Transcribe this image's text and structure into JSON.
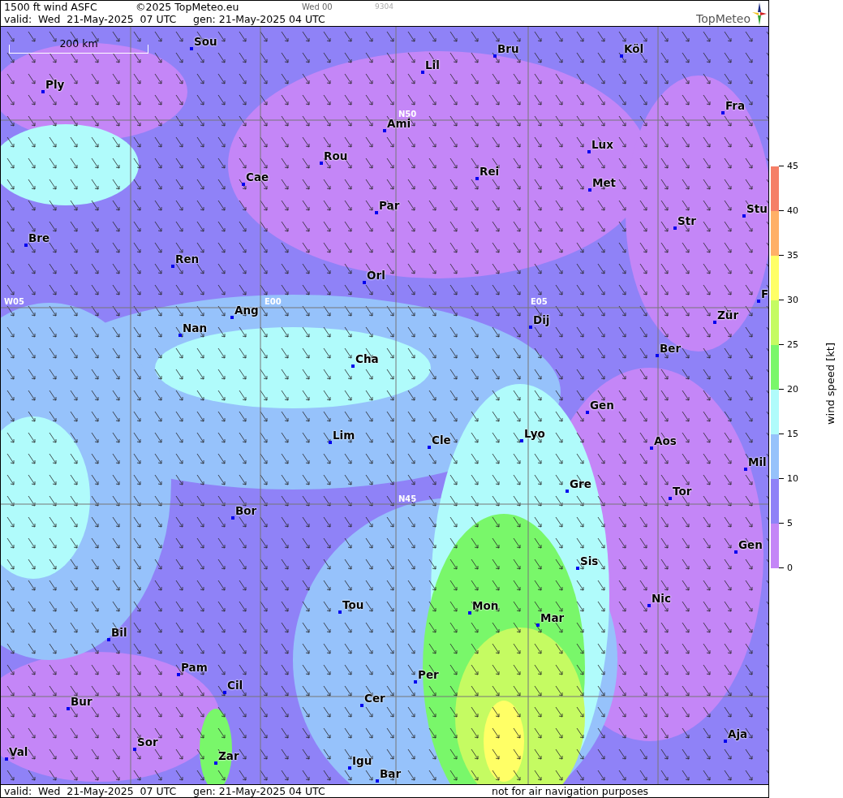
{
  "header": {
    "title": "1500 ft wind ASFC",
    "copyright": "©2025 TopMeteo.eu",
    "run": "Wed 00",
    "code": "9304",
    "valid": "valid:  Wed  21-May-2025  07 UTC",
    "gen": "gen: 21-May-2025 04 UTC"
  },
  "logo": {
    "text": "TopMeteo"
  },
  "map": {
    "scale": "200 km",
    "grid_labels": [
      "N50",
      "W05",
      "E00",
      "E05",
      "N45"
    ],
    "cities": [
      {
        "name": "Sou"
      },
      {
        "name": "Lil"
      },
      {
        "name": "Bru"
      },
      {
        "name": "Köl"
      },
      {
        "name": "Ply"
      },
      {
        "name": "Ami"
      },
      {
        "name": "Fra"
      },
      {
        "name": "Lux"
      },
      {
        "name": "Rou"
      },
      {
        "name": "Cae"
      },
      {
        "name": "Rei"
      },
      {
        "name": "Met"
      },
      {
        "name": "Par"
      },
      {
        "name": "Bre"
      },
      {
        "name": "Stu"
      },
      {
        "name": "Str"
      },
      {
        "name": "Ren"
      },
      {
        "name": "Orl"
      },
      {
        "name": "F"
      },
      {
        "name": "Ang"
      },
      {
        "name": "Nan"
      },
      {
        "name": "Dij"
      },
      {
        "name": "Zür"
      },
      {
        "name": "Cha"
      },
      {
        "name": "Ber"
      },
      {
        "name": "Gen"
      },
      {
        "name": "Lim"
      },
      {
        "name": "Cle"
      },
      {
        "name": "Lyo"
      },
      {
        "name": "Aos"
      },
      {
        "name": "Mil"
      },
      {
        "name": "Gre"
      },
      {
        "name": "Tor"
      },
      {
        "name": "Bor"
      },
      {
        "name": "Gen"
      },
      {
        "name": "Sis"
      },
      {
        "name": "Tou"
      },
      {
        "name": "Mon"
      },
      {
        "name": "Nic"
      },
      {
        "name": "Mar"
      },
      {
        "name": "Bil"
      },
      {
        "name": "Pam"
      },
      {
        "name": "Per"
      },
      {
        "name": "Cil"
      },
      {
        "name": "Cer"
      },
      {
        "name": "Bur"
      },
      {
        "name": "Sor"
      },
      {
        "name": "Aja"
      },
      {
        "name": "Val"
      },
      {
        "name": "Zar"
      },
      {
        "name": "Igu"
      },
      {
        "name": "Bar"
      }
    ]
  },
  "legend": {
    "label": "wind speed [kt]",
    "ticks": [
      "45",
      "40",
      "35",
      "30",
      "25",
      "20",
      "15",
      "10",
      "5",
      "0"
    ],
    "bands": [
      {
        "color": "#f57f67"
      },
      {
        "color": "#ffb067"
      },
      {
        "color": "#ffff66"
      },
      {
        "color": "#c5fb62"
      },
      {
        "color": "#79f76a"
      },
      {
        "color": "#b0fbfb"
      },
      {
        "color": "#96c2fb"
      },
      {
        "color": "#8f82f7"
      },
      {
        "color": "#c486f7"
      }
    ]
  },
  "footer": {
    "valid": "valid:  Wed  21-May-2025  07 UTC",
    "gen": "gen: 21-May-2025 04 UTC",
    "disclaimer": "not for air navigation purposes"
  }
}
